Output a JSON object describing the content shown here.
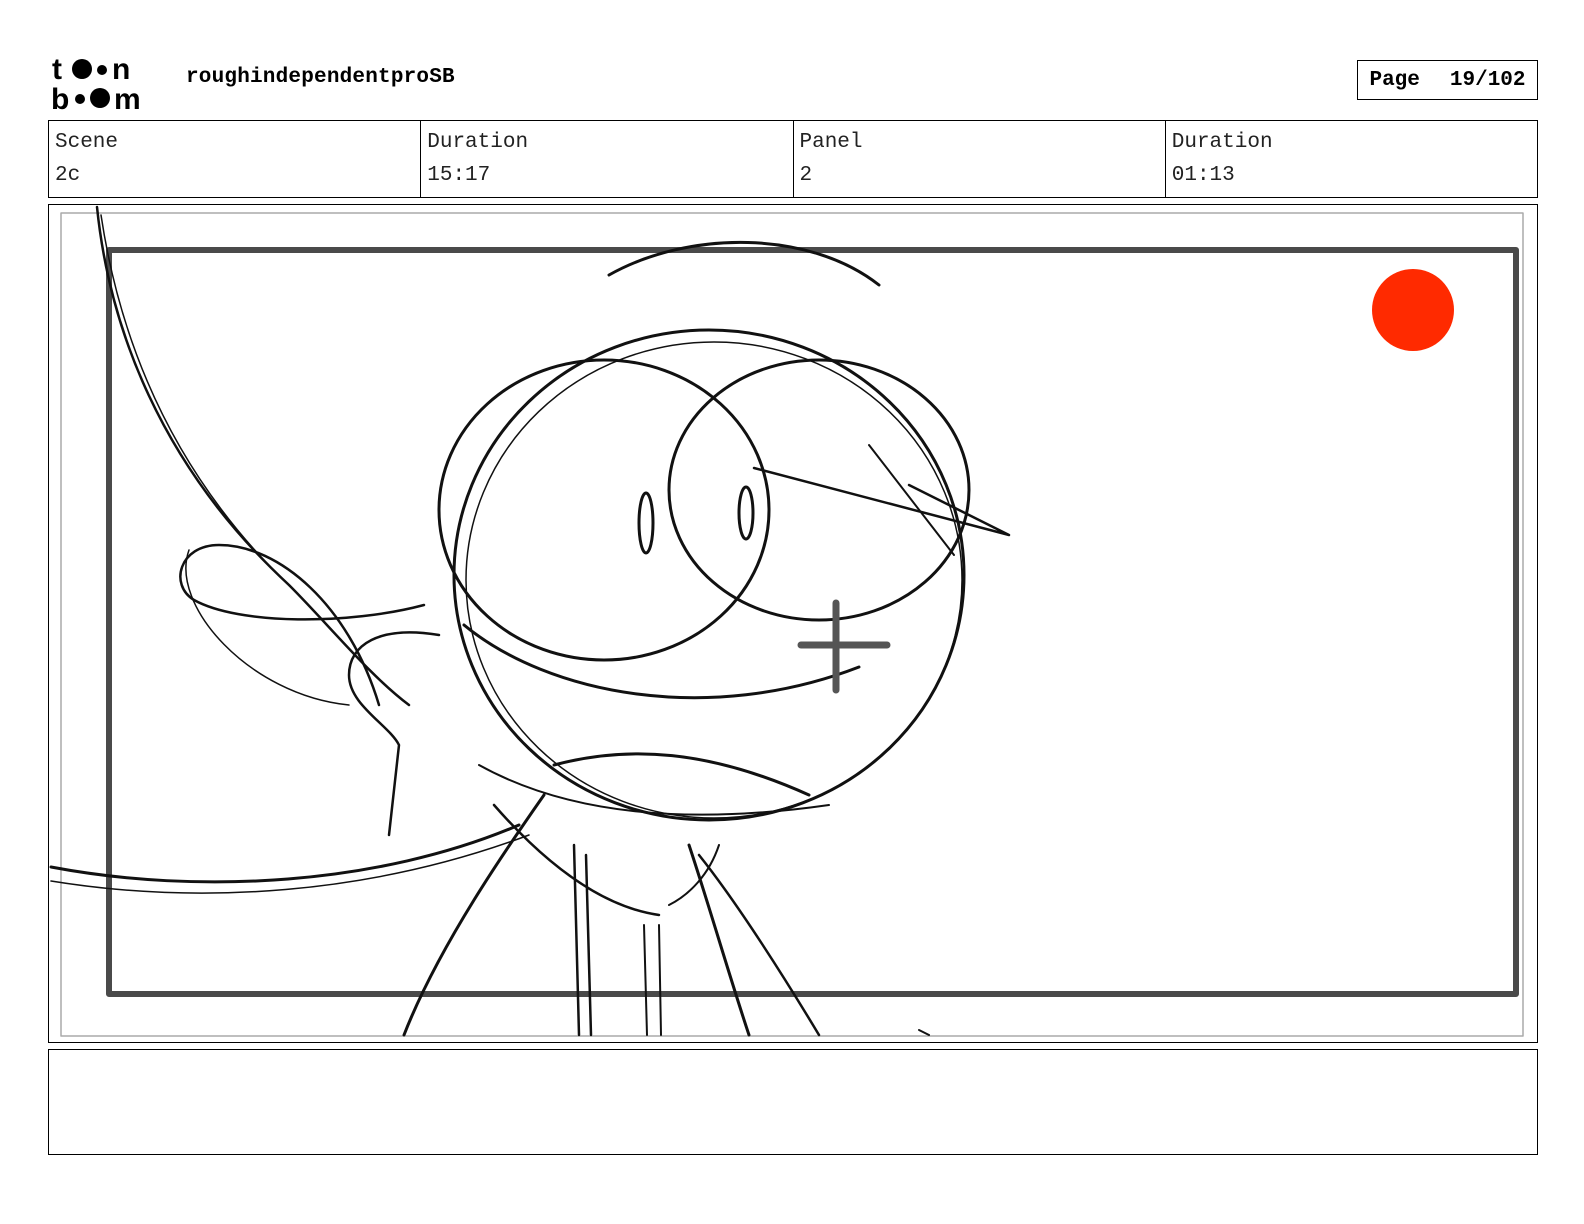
{
  "header": {
    "logo_text": "toon boom",
    "project_title": "roughindependentproSB",
    "page_label": "Page",
    "page_number": "19/102"
  },
  "info": {
    "scene_label": "Scene",
    "scene_value": "2c",
    "scene_duration_label": "Duration",
    "scene_duration_value": "15:17",
    "panel_label": "Panel",
    "panel_value": "2",
    "panel_duration_label": "Duration",
    "panel_duration_value": "01:13"
  },
  "notes": {
    "text": ""
  },
  "colors": {
    "marker_red": "#ff2a00",
    "frame_gray": "#4a4a4a"
  }
}
